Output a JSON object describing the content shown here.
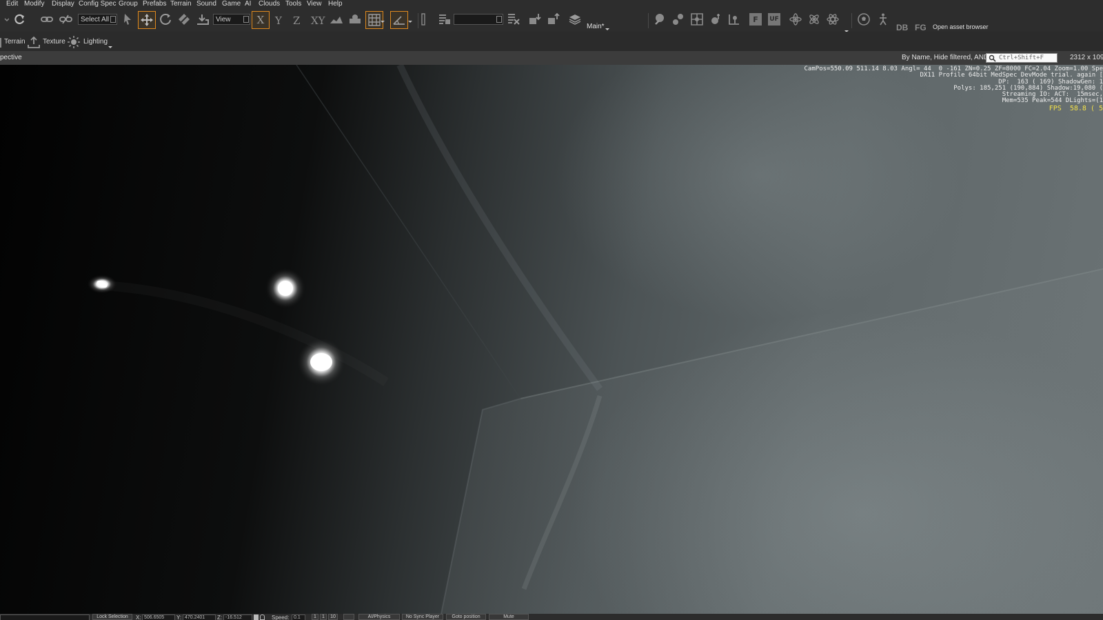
{
  "menu": [
    "Edit",
    "Modify",
    "Display",
    "Config Spec",
    "Group",
    "Prefabs",
    "Terrain",
    "Sound",
    "Game",
    "AI",
    "Clouds",
    "Tools",
    "View",
    "Help"
  ],
  "toolbar": {
    "select_all": "Select All",
    "axis_x": "X",
    "axis_y": "Y",
    "axis_z": "Z",
    "axis_xy": "XY",
    "view_combo": "View",
    "layer": "Main*",
    "db": "DB",
    "fg": "FG",
    "f_btn": "F",
    "uf_btn": "UF",
    "open_asset_browser": "Open asset browser"
  },
  "toolbar2": {
    "terrain": "Terrain",
    "texture": "Texture",
    "lighting": "Lighting"
  },
  "viewport_header": {
    "title": "pective",
    "filter": "By Name, Hide filtered, AND",
    "search_placeholder": "Ctrl+Shift+F",
    "resolution": "2312 x 109"
  },
  "hud": {
    "line1": "CamPos=550.09 511.14 8.03 Angl= 44  0 -161 ZN=0.25 ZF=8000 FC=2.04 Zoom=1.00 Spe",
    "line2": "DX11 Profile 64bit MedSpec DevMode trial. again [",
    "line3": "DP:  163 ( 169) ShadowGen: 1",
    "line4": "Polys: 185,251 (190,884) Shadow:19,080 (",
    "line5": "Streaming IO: ACT:  15msec,",
    "line6": "Mem=535 Peak=544 DLights=(1",
    "fps": "FPS  58.8 ( 5"
  },
  "status": {
    "lock_selection": "Lock Selection",
    "x_label": "X:",
    "x_value": "506.6505",
    "y_label": "Y:",
    "y_value": "470.2401",
    "z_label": "Z:",
    "z_value": "-16.512",
    "speed_label": "Speed:",
    "speed_value": "0.1",
    "speed_1": "1",
    "speed_2": "1",
    "speed_3": "10",
    "ai_physics": "AI/Physics",
    "no_sync_player": "No Sync Player",
    "goto_position": "Goto position",
    "mute": "Mute"
  },
  "colors": {
    "accent": "#e08a1e",
    "fps": "#f4e24a",
    "background": "#2d2d2d"
  }
}
